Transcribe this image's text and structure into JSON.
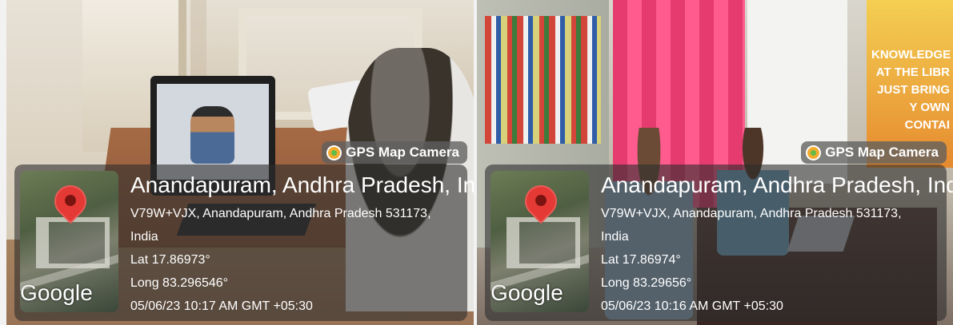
{
  "photos": [
    {
      "badge": {
        "icon": "gps-map-camera-icon",
        "label": "GPS Map Camera"
      },
      "map": {
        "icon": "map-pin-icon",
        "logo_text": "Google"
      },
      "location_title": "Anandapuram, Andhra Pradesh, India",
      "address_line1": "V79W+VJX, Anandapuram, Andhra Pradesh 531173,",
      "address_line2": "India",
      "lat": "Lat 17.86973°",
      "long": "Long 83.296546°",
      "timestamp": "05/06/23 10:17 AM GMT +05:30"
    },
    {
      "badge": {
        "icon": "gps-map-camera-icon",
        "label": "GPS Map Camera"
      },
      "map": {
        "icon": "map-pin-icon",
        "logo_text": "Google"
      },
      "location_title": "Anandapuram, Andhra Pradesh, India",
      "address_line1": "V79W+VJX, Anandapuram, Andhra Pradesh 531173,",
      "address_line2": "India",
      "lat": "Lat 17.86974°",
      "long": "Long 83.29656°",
      "timestamp": "05/06/23 10:16 AM GMT +05:30"
    }
  ],
  "background": {
    "right_poster_text": "KNOWLEDGE AT THE LIBR JUST BRING Y OWN CONTAI"
  }
}
